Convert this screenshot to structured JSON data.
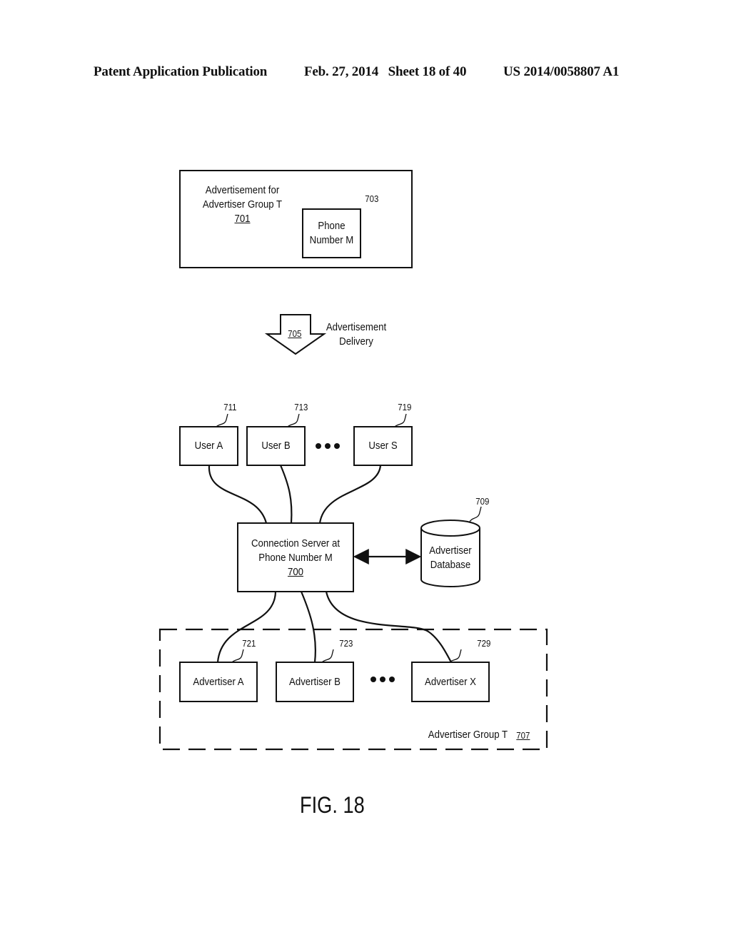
{
  "header": {
    "left": "Patent Application Publication",
    "date_sheet": "Feb. 27, 2014   Sheet 18 of 40",
    "number": "US 2014/0058807 A1"
  },
  "advertisement": {
    "line1": "Advertisement for",
    "line2": "Advertiser Group T",
    "ref": "701",
    "phone_line1": "Phone",
    "phone_line2": "Number  M",
    "phone_ref": "703"
  },
  "delivery": {
    "ref": "705",
    "line1": "Advertisement",
    "line2": "Delivery"
  },
  "users": [
    {
      "label": "User A",
      "ref": "711"
    },
    {
      "label": "User B",
      "ref": "713"
    },
    {
      "label": "User S",
      "ref": "719"
    }
  ],
  "ellipsis": "●●●",
  "server": {
    "line1": "Connection Server at",
    "line2": "Phone Number  M",
    "ref": "700"
  },
  "database": {
    "line1": "Advertiser",
    "line2": "Database",
    "ref": "709"
  },
  "advertisers": [
    {
      "label": "Advertiser A",
      "ref": "721"
    },
    {
      "label": "Advertiser B",
      "ref": "723"
    },
    {
      "label": "Advertiser X",
      "ref": "729"
    }
  ],
  "group": {
    "label": "Advertiser Group T",
    "ref": "707"
  },
  "figure_label": "FIG. 18"
}
